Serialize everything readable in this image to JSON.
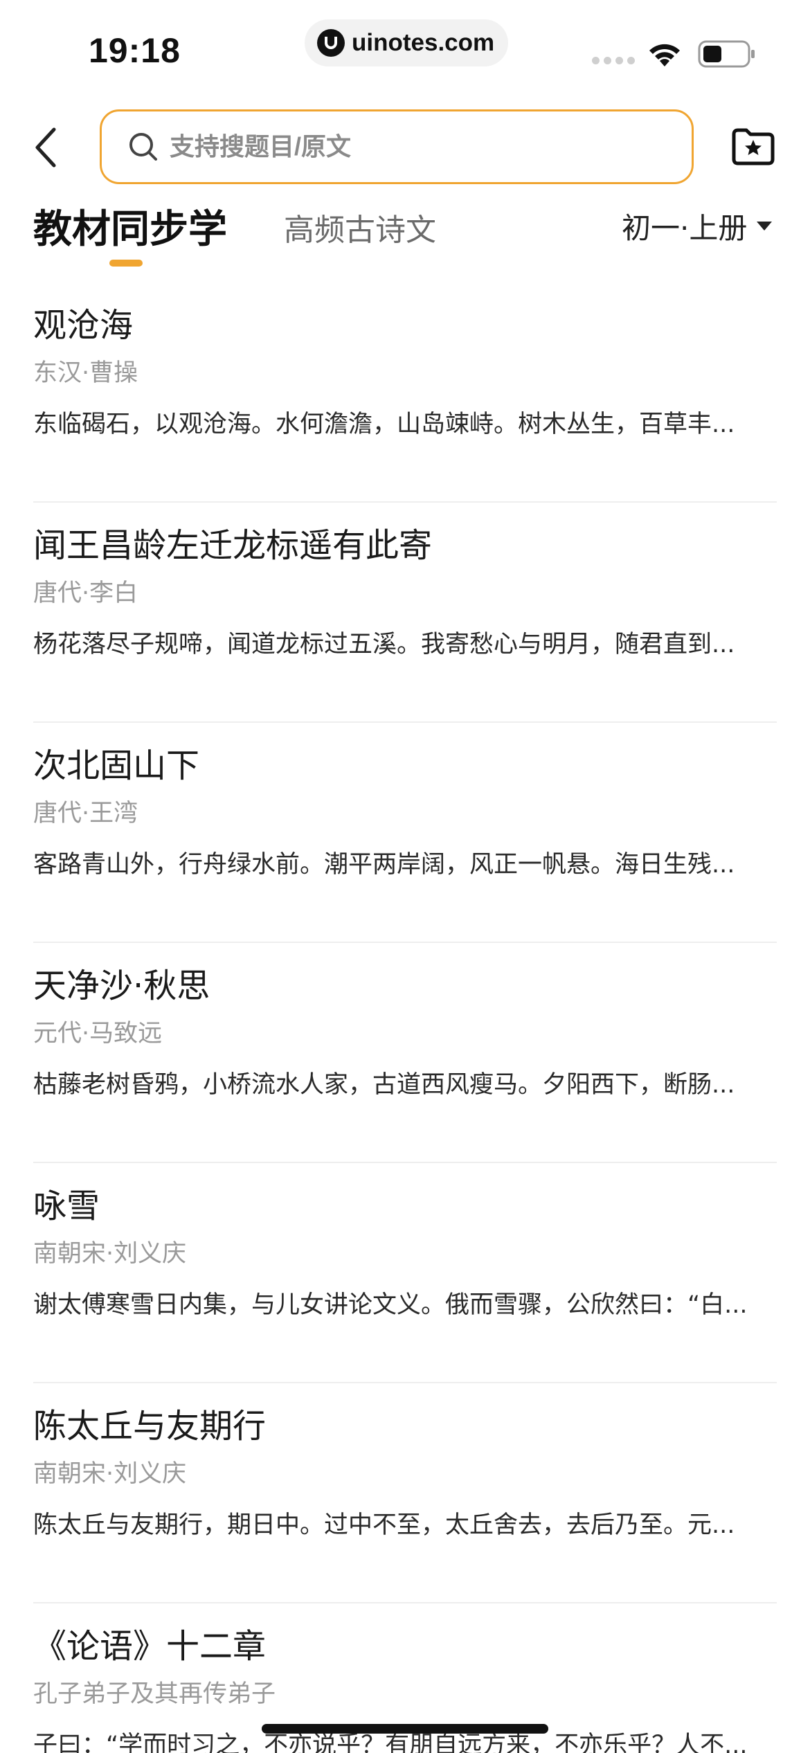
{
  "status_bar": {
    "time": "19:18",
    "url": "uinotes.com"
  },
  "header": {
    "search_placeholder": "支持搜题目/原文"
  },
  "tabs": {
    "primary": "教材同步学",
    "secondary": "高频古诗文",
    "grade": "初一·上册"
  },
  "colors": {
    "accent": "#f0a531"
  },
  "poems": [
    {
      "title": "观沧海",
      "author": "东汉·曹操",
      "excerpt": "东临碣石，以观沧海。水何澹澹，山岛竦峙。树木丛生，百草丰..."
    },
    {
      "title": "闻王昌龄左迁龙标遥有此寄",
      "author": "唐代·李白",
      "excerpt": "杨花落尽子规啼，闻道龙标过五溪。我寄愁心与明月，随君直到..."
    },
    {
      "title": "次北固山下",
      "author": "唐代·王湾",
      "excerpt": "客路青山外，行舟绿水前。潮平两岸阔，风正一帆悬。海日生残..."
    },
    {
      "title": "天净沙·秋思",
      "author": "元代·马致远",
      "excerpt": "枯藤老树昏鸦，小桥流水人家，古道西风瘦马。夕阳西下，断肠..."
    },
    {
      "title": "咏雪",
      "author": "南朝宋·刘义庆",
      "excerpt": "谢太傅寒雪日内集，与儿女讲论文义。俄而雪骤，公欣然曰：“白..."
    },
    {
      "title": "陈太丘与友期行",
      "author": "南朝宋·刘义庆",
      "excerpt": "陈太丘与友期行，期日中。过中不至，太丘舍去，去后乃至。元..."
    },
    {
      "title": "《论语》十二章",
      "author": "孔子弟子及其再传弟子",
      "excerpt": "子曰：“学而时习之，不亦说乎？有朋自远方来，不亦乐乎？人不..."
    }
  ]
}
